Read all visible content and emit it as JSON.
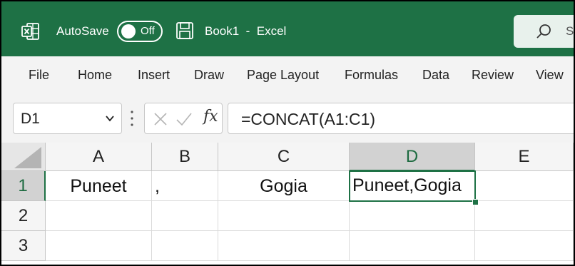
{
  "app": {
    "autosave_label": "AutoSave",
    "autosave_state": "Off",
    "document_title": "Book1  -  Excel",
    "search_text": "S",
    "colors": {
      "brand": "#1e7145",
      "accent": "#1e7145"
    }
  },
  "menu": {
    "items": [
      "File",
      "Home",
      "Insert",
      "Draw",
      "Page Layout",
      "Formulas",
      "Data",
      "Review",
      "View"
    ]
  },
  "formula_bar": {
    "name_box": "D1",
    "fx_label": "fx",
    "formula": "=CONCAT(A1:C1)"
  },
  "sheet": {
    "columns": [
      "A",
      "B",
      "C",
      "D",
      "E"
    ],
    "rows": [
      "1",
      "2",
      "3"
    ],
    "active_cell": "D1",
    "cells": {
      "A1": "Puneet",
      "B1": ",",
      "C1": "Gogia",
      "D1": "Puneet,Gogia"
    }
  }
}
